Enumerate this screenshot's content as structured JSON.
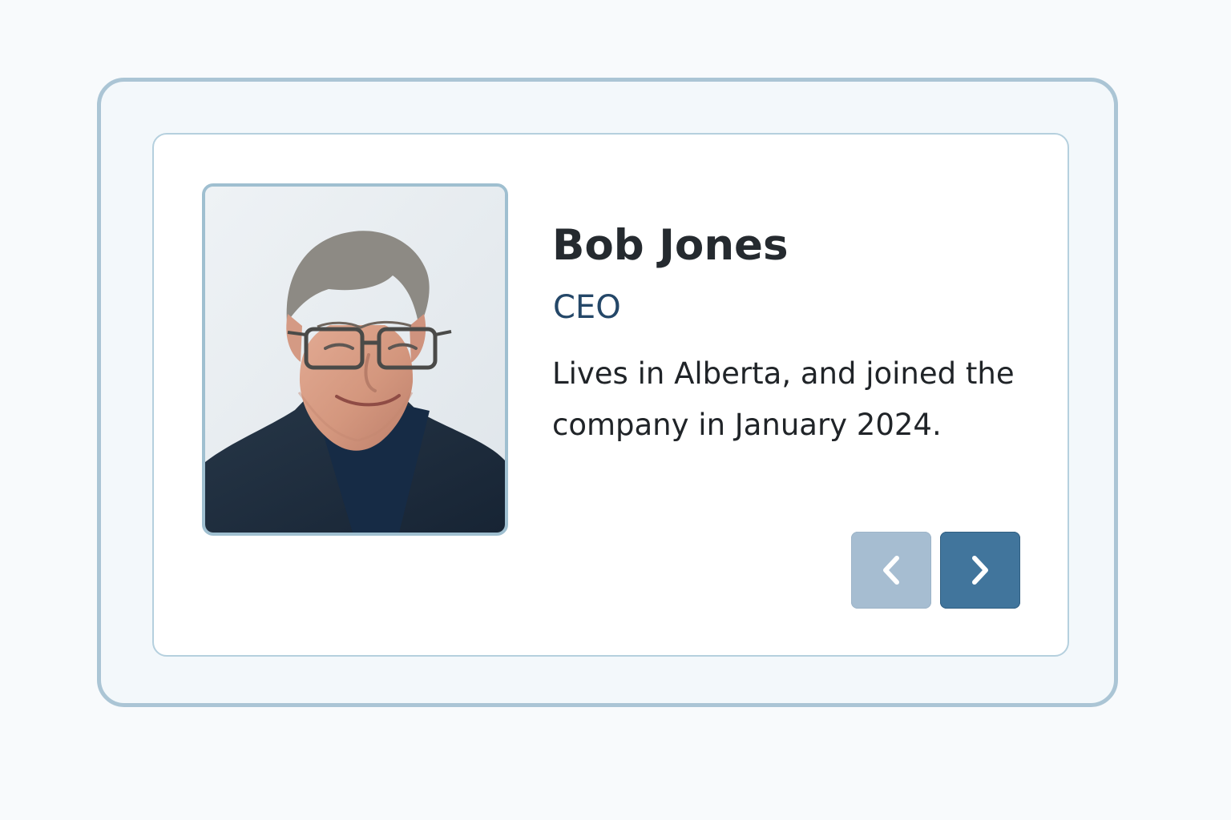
{
  "profile": {
    "name": "Bob Jones",
    "role": "CEO",
    "bio": "Lives in Alberta, and joined the company in January 2024.",
    "photo": "portrait-photo"
  },
  "navigation": {
    "previous_icon": "chevron-left-icon",
    "next_icon": "chevron-right-icon"
  },
  "colors": {
    "background": "#f8fafc",
    "outer_border": "#abc5d5",
    "card_background": "#ffffff",
    "title_text": "#252a2f",
    "role_text": "#244768",
    "button_disabled": "#a6bdd1",
    "button_active": "#41759c"
  }
}
